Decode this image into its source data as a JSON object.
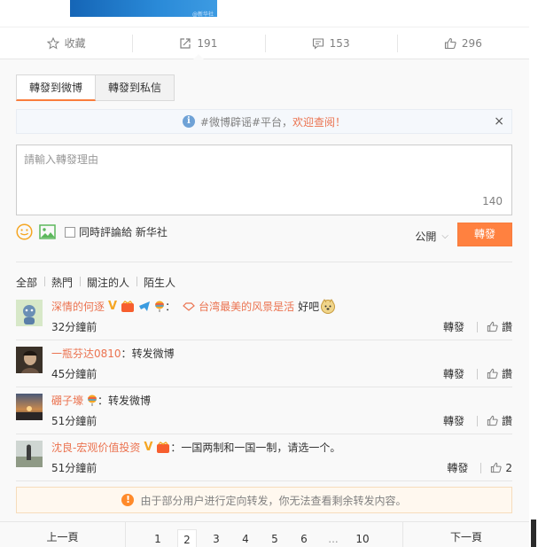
{
  "actions": [
    {
      "icon": "star-icon",
      "label": "收藏"
    },
    {
      "icon": "forward-icon",
      "label": "191"
    },
    {
      "icon": "comment-icon",
      "label": "153"
    },
    {
      "icon": "like-icon",
      "label": "296"
    }
  ],
  "media_watermark": "@新华社",
  "tabs": [
    {
      "label": "轉發到微博",
      "active": true
    },
    {
      "label": "轉發到私信",
      "active": false
    }
  ],
  "notice": {
    "text": "#微博辟谣#平台，",
    "link": "欢迎查阅！",
    "close": "×"
  },
  "composer": {
    "placeholder": "請輸入轉發理由",
    "count": "140"
  },
  "tools": {
    "checkbox_label": "同時評論給 新华社",
    "visibility": "公開",
    "send_label": "轉發"
  },
  "filters": [
    "全部",
    "熱門",
    "關注的人",
    "陌生人"
  ],
  "reposts": [
    {
      "nick": "深情的何逐",
      "sep": "：",
      "topic": "台湾最美的风景是活",
      "text": "好吧",
      "time": "32分鐘前",
      "repost": "轉發",
      "like": "讚"
    },
    {
      "nick": "一瓶芬达0810",
      "sep": "：",
      "text": "转发微博",
      "time": "45分鐘前",
      "repost": "轉發",
      "like": "讚"
    },
    {
      "nick": "硼子壕",
      "sep": "：",
      "text": "转发微博",
      "time": "51分鐘前",
      "repost": "轉發",
      "like": "讚"
    },
    {
      "nick": "沈良-宏观价值投资",
      "sep": "：",
      "text": "一国两制和一国一制，请选一个。",
      "time": "51分鐘前",
      "repost": "轉發",
      "like": "2"
    }
  ],
  "warning": "由于部分用户进行定向转发，你无法查看剩余转发内容。",
  "pager": {
    "prev": "上一頁",
    "next": "下一頁",
    "pages": [
      "1",
      "2",
      "3",
      "4",
      "5",
      "6",
      "...",
      "10"
    ],
    "current": "2"
  },
  "colors": {
    "accent": "#ff8140",
    "link": "#eb7350",
    "info": "#6fa2d6"
  }
}
